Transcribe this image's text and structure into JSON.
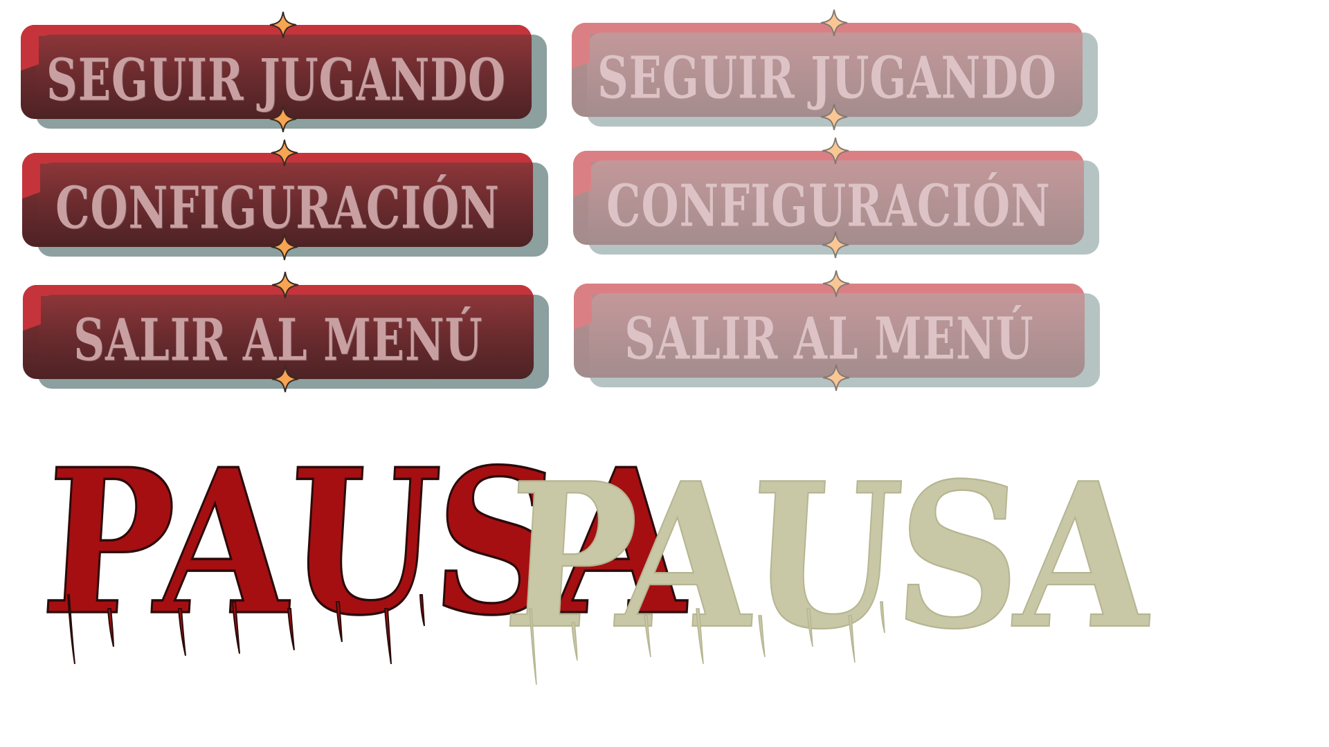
{
  "pause_menu": {
    "buttons": [
      {
        "label": "SEGUIR JUGANDO"
      },
      {
        "label": "CONFIGURACIÓN"
      },
      {
        "label": "SALIR AL MENÚ"
      }
    ],
    "faded_buttons": [
      {
        "label": "SEGUIR JUGANDO"
      },
      {
        "label": "CONFIGURACIÓN"
      },
      {
        "label": "SALIR AL MENÚ"
      }
    ]
  },
  "title": {
    "text": "PAUSA",
    "faded_text": "PAUSA"
  },
  "colors": {
    "button_label": "#c9a0a2",
    "star_fill": "#f7a553",
    "title_red": "#a50f11",
    "title_pale": "#c8c8a6"
  },
  "icons": {
    "ornament": "diamond-star-icon"
  }
}
